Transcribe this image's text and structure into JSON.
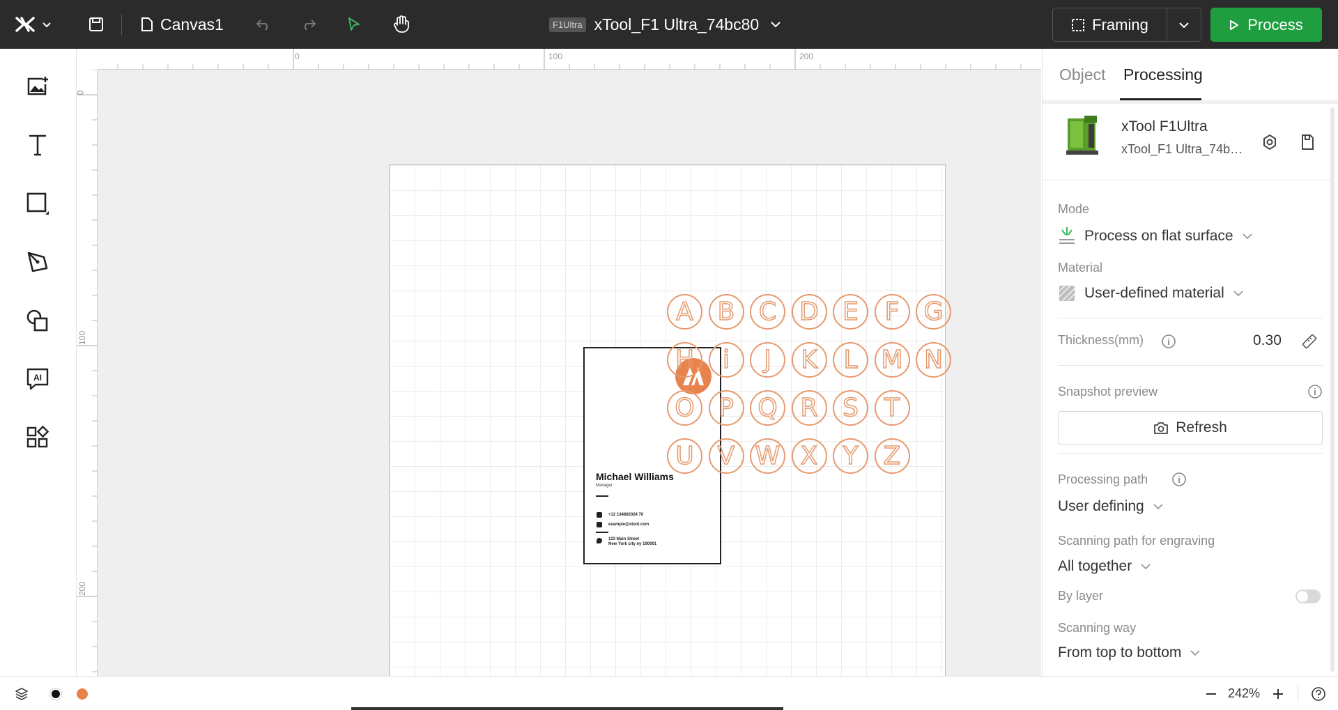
{
  "topbar": {
    "canvas_name": "Canvas1",
    "device_tag": "F1Ultra",
    "device_title": "xTool_F1 Ultra_74bc80",
    "framing_label": "Framing",
    "process_label": "Process"
  },
  "left_tools": [
    "image-icon",
    "text-icon",
    "shape-icon",
    "pen-icon",
    "elements-icon",
    "ai-icon",
    "apps-icon"
  ],
  "rulers": {
    "top": [
      "0",
      "100",
      "200"
    ],
    "left": [
      "0",
      "100",
      "200"
    ]
  },
  "business_card": {
    "name": "Michael Williams",
    "role": "Manager",
    "phone": "+12 134802024 70",
    "email": "example@xtool.com",
    "address_line1": "123 Main Street",
    "address_line2": "New York city ny 100001"
  },
  "letters": [
    "A",
    "B",
    "C",
    "D",
    "E",
    "F",
    "G",
    "H",
    "i",
    "J",
    "K",
    "L",
    "M",
    "N",
    "O",
    "P",
    "Q",
    "R",
    "S",
    "T",
    "U",
    "V",
    "W",
    "X",
    "Y",
    "Z"
  ],
  "panel": {
    "tabs": [
      "Object",
      "Processing"
    ],
    "active_tab": "Processing",
    "device_name": "xTool F1Ultra",
    "device_sub": "xTool_F1 Ultra_74bc80",
    "mode_label": "Mode",
    "mode_value": "Process on flat surface",
    "material_label": "Material",
    "material_value": "User-defined material",
    "thickness_label": "Thickness(mm)",
    "thickness_value": "0.30",
    "snapshot_label": "Snapshot preview",
    "refresh_label": "Refresh",
    "processing_path_label": "Processing path",
    "processing_path_value": "User defining",
    "scanning_path_label": "Scanning path for engraving",
    "scanning_path_value": "All together",
    "by_layer_label": "By layer",
    "by_layer_on": false,
    "scanning_way_label": "Scanning way",
    "scanning_way_value": "From top to bottom"
  },
  "statusbar": {
    "zoom": "242%",
    "layer_colors": [
      "#111111",
      "#e8834d"
    ]
  },
  "colors": {
    "accent_green": "#1f9e3f",
    "topbar_bg": "#2b2b2b",
    "letter_stroke": "#e59a6e"
  }
}
